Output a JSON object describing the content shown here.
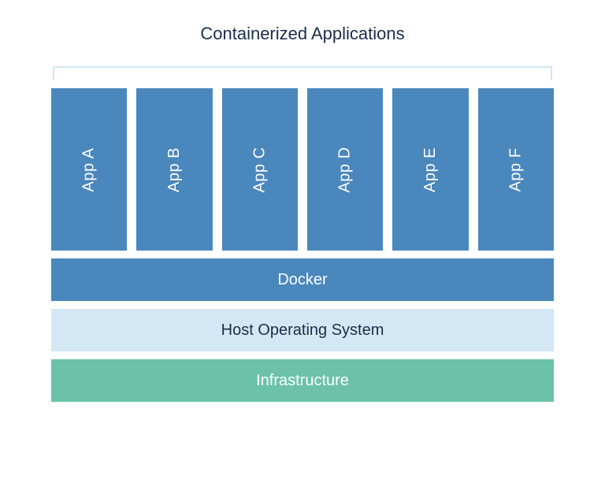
{
  "title": "Containerized Applications",
  "apps": {
    "0": "App A",
    "1": "App B",
    "2": "App C",
    "3": "App D",
    "4": "App E",
    "5": "App F"
  },
  "layers": {
    "docker": "Docker",
    "host": "Host Operating System",
    "infra": "Infrastructure"
  },
  "colors": {
    "app_bg": "#4a87bd",
    "docker_bg": "#4a87bd",
    "host_bg": "#d4e7f5",
    "infra_bg": "#6cc2a9",
    "bracket": "#cfe6f5",
    "text_dark": "#1a2e4a",
    "text_light": "#ffffff"
  }
}
